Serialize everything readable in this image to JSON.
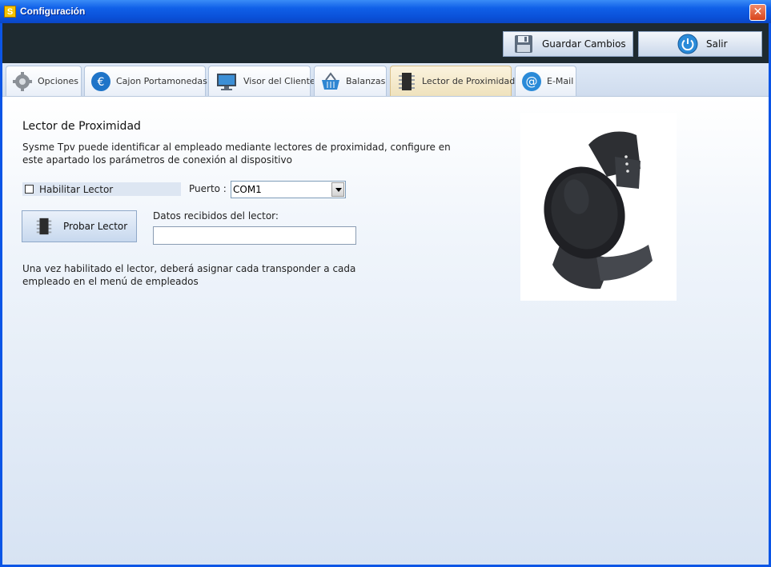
{
  "window": {
    "title": "Configuración",
    "app_icon_letter": "S",
    "close_glyph": "✕"
  },
  "toolbar": {
    "save_label": "Guardar Cambios",
    "exit_label": "Salir"
  },
  "tabs": [
    {
      "label": "Opciones",
      "icon": "gear-icon"
    },
    {
      "label": "Cajon Portamonedas",
      "icon": "euro-icon"
    },
    {
      "label": "Visor del Cliente",
      "icon": "monitor-icon"
    },
    {
      "label": "Balanzas",
      "icon": "basket-icon"
    },
    {
      "label": "Lector de Proximidad",
      "icon": "chip-icon",
      "active": true
    },
    {
      "label": "E-Mail",
      "icon": "at-icon"
    }
  ],
  "panel": {
    "title": "Lector de Proximidad",
    "description": "Sysme Tpv puede identificar al empleado mediante lectores de proximidad, configure en este apartado los parámetros de conexión al dispositivo",
    "enable_label": "Habilitar Lector",
    "enable_checked": false,
    "port_label": "Puerto :",
    "port_value": "COM1",
    "test_button_label": "Probar Lector",
    "received_label": "Datos recibidos del lector:",
    "received_value": "",
    "note": "Una vez habilitado el lector, deberá asignar cada transponder a cada empleado en el menú de empleados",
    "image": "proximity-wristband"
  },
  "colors": {
    "titlebar": "#0a50d8",
    "toolbar": "#1e2a30",
    "active_tab": "#efe2bd"
  }
}
